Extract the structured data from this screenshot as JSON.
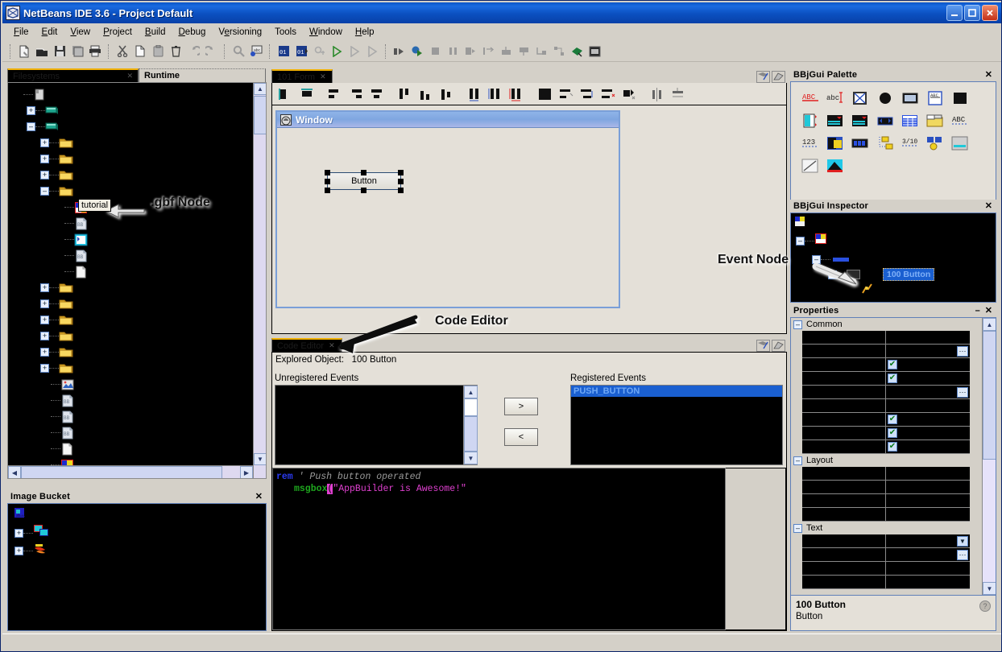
{
  "window": {
    "title": "NetBeans IDE 3.6 - Project Default",
    "icon": "netbeans-icon",
    "minimize": "0",
    "maximize": "1",
    "close": "X"
  },
  "menubar": {
    "items": [
      {
        "label": "File",
        "mnemonic": "F"
      },
      {
        "label": "Edit",
        "mnemonic": "E"
      },
      {
        "label": "View",
        "mnemonic": "V"
      },
      {
        "label": "Project",
        "mnemonic": "P"
      },
      {
        "label": "Build",
        "mnemonic": "B"
      },
      {
        "label": "Debug",
        "mnemonic": "D"
      },
      {
        "label": "Versioning",
        "mnemonic": "e"
      },
      {
        "label": "Tools",
        "mnemonic": "T"
      },
      {
        "label": "Window",
        "mnemonic": "W"
      },
      {
        "label": "Help",
        "mnemonic": "H"
      }
    ]
  },
  "toolbar": {
    "groups": [
      [
        "new-file-icon",
        "open-file-icon",
        "save-icon",
        "save-all-icon",
        "print-icon"
      ],
      [
        "cut-icon",
        "copy-icon",
        "paste-icon",
        "delete-icon",
        "undo-icon",
        "redo-icon"
      ],
      [
        "find-icon",
        "find-replace-icon"
      ],
      [
        "compile-icon",
        "compile-all-icon",
        "execute-stop-icon",
        "run-icon",
        "run-step-icon",
        "run-continue-icon"
      ],
      [
        "debug-step-icon",
        "debug-run-icon",
        "stop-icon",
        "pause-icon",
        "step-over-icon",
        "step-into-icon",
        "step-out-icon",
        "run-to-cursor-icon",
        "step-return-icon",
        "breakpoint-icon",
        "watch-icon",
        "debug-window-icon"
      ]
    ]
  },
  "explorer": {
    "tabs": [
      {
        "label": "Filesystems",
        "active": true,
        "closable": true
      },
      {
        "label": "Runtime",
        "active": false,
        "closable": false
      }
    ],
    "tree": {
      "nodes": [
        {
          "icon": "repository-icon",
          "depth": 0,
          "handle": ""
        },
        {
          "icon": "filesystem-icon",
          "depth": 1,
          "handle": "+"
        },
        {
          "icon": "filesystem-icon",
          "depth": 1,
          "handle": "-"
        },
        {
          "icon": "folder-icon",
          "depth": 2,
          "handle": "+"
        },
        {
          "icon": "folder-icon",
          "depth": 2,
          "handle": "+"
        },
        {
          "icon": "folder-icon",
          "depth": 2,
          "handle": "+"
        },
        {
          "icon": "folder-icon",
          "depth": 2,
          "handle": "-"
        },
        {
          "icon": "gbf-form-icon",
          "depth": 3,
          "handle": ""
        },
        {
          "icon": "bbj-program-icon",
          "depth": 3,
          "handle": ""
        },
        {
          "icon": "gbf-node-icon",
          "depth": 3,
          "handle": ""
        },
        {
          "icon": "bbj-program-icon",
          "depth": 3,
          "handle": ""
        },
        {
          "icon": "text-file-icon",
          "depth": 3,
          "handle": ""
        },
        {
          "icon": "folder-icon",
          "depth": 2,
          "handle": "+"
        },
        {
          "icon": "folder-icon",
          "depth": 2,
          "handle": "+"
        },
        {
          "icon": "folder-icon",
          "depth": 2,
          "handle": "+"
        },
        {
          "icon": "folder-icon",
          "depth": 2,
          "handle": "+"
        },
        {
          "icon": "folder-icon",
          "depth": 2,
          "handle": "+"
        },
        {
          "icon": "folder-icon",
          "depth": 2,
          "handle": "+"
        },
        {
          "icon": "image-file-icon",
          "depth": 2,
          "handle": ""
        },
        {
          "icon": "bbj-program-icon",
          "depth": 2,
          "handle": ""
        },
        {
          "icon": "bbj-program-icon",
          "depth": 2,
          "handle": ""
        },
        {
          "icon": "bbj-program-icon",
          "depth": 2,
          "handle": ""
        },
        {
          "icon": "text-file-icon",
          "depth": 2,
          "handle": ""
        },
        {
          "icon": "gbf-form-icon",
          "depth": 2,
          "handle": ""
        },
        {
          "icon": "bbj-program-icon",
          "depth": 2,
          "handle": ""
        },
        {
          "icon": "bbj-program-icon",
          "depth": 2,
          "handle": ""
        },
        {
          "icon": "bbj-program-icon",
          "depth": 2,
          "handle": ""
        },
        {
          "icon": "bbj-program-icon",
          "depth": 2,
          "handle": ""
        },
        {
          "icon": "bbj-program-icon",
          "depth": 2,
          "handle": ""
        }
      ]
    },
    "tooltip": "tutorial"
  },
  "image_bucket": {
    "title": "Image Bucket",
    "close": "✕",
    "nodes": [
      {
        "icon": "image-bucket-root-icon",
        "handle": ""
      },
      {
        "icon": "image-group-icon",
        "handle": "+"
      },
      {
        "icon": "image-group-icon",
        "handle": "+"
      }
    ]
  },
  "form_editor": {
    "tab": {
      "label": "101 Form",
      "close": "✕"
    },
    "window_buttons": [
      "float-icon",
      "maximize-icon"
    ],
    "designer_toolbar": [
      "align-left-edge-icon",
      "align-top-edge-icon",
      "align-left-icon",
      "align-right-icon",
      "align-center-icon",
      "align-top-icon",
      "align-bottom-icon",
      "align-middle-icon",
      "same-width-icon",
      "same-height-icon",
      "same-size-icon",
      "fill-icon",
      "space-horizontal-icon",
      "space-vertical-icon",
      "space-equal-icon",
      "group-icon",
      "center-horizontal-icon",
      "center-vertical-icon"
    ],
    "window": {
      "title": "Window",
      "icon": "window-icon",
      "button": {
        "label": "Button",
        "selected": true
      }
    }
  },
  "code_editor": {
    "tab": {
      "label": "Code Editor",
      "close": "✕"
    },
    "window_buttons": [
      "float-icon",
      "maximize-icon"
    ],
    "explored_object_label": "Explored Object:",
    "explored_object_value": "100 Button",
    "unregistered_label": "Unregistered Events",
    "registered_label": "Registered Events",
    "unregistered_events": [],
    "registered_events": [
      "PUSH_BUTTON"
    ],
    "add_button": ">",
    "remove_button": "<",
    "code": {
      "line1": {
        "keyword": "rem",
        "comment": "' Push button operated"
      },
      "line2": {
        "func": "msgbox",
        "caret": "(",
        "string": "\"AppBuilder is Awesome!\""
      }
    }
  },
  "palette": {
    "title": "BBjGui Palette",
    "close": "✕",
    "items": [
      "static-text-icon",
      "edit-field-icon",
      "checkbox-icon",
      "radio-button-icon",
      "button-icon",
      "child-window-icon",
      "list-button-icon",
      "list-edit-icon",
      "list-box-icon",
      "list-spinner-icon",
      "navigator-icon",
      "grid-icon",
      "tab-control-icon",
      "input-text-icon",
      "input-numeric-icon",
      "image-control-icon",
      "progress-bar-icon",
      "tree-icon",
      "status-bar-icon",
      "menu-icon",
      "scroll-bar-icon",
      "line-icon",
      "chart-icon"
    ]
  },
  "inspector": {
    "title": "BBjGui Inspector",
    "close": "✕",
    "nodes": [
      {
        "icon": "app-root-icon"
      },
      {
        "icon": "gbf-form-icon",
        "handle": "-"
      },
      {
        "icon": "window-node-icon",
        "handle": "-"
      },
      {
        "icon": "control-node-icon",
        "handle": "-"
      }
    ],
    "selected_node": "100 Button",
    "event_node_icon": "event-node-icon"
  },
  "properties": {
    "title": "Properties",
    "minimize": "–",
    "close": "✕",
    "sections": [
      {
        "name": "Common",
        "rows": [
          {
            "editor": "none"
          },
          {
            "editor": "ellipsis"
          },
          {
            "editor": "checkbox"
          },
          {
            "editor": "checkbox"
          },
          {
            "editor": "ellipsis"
          },
          {
            "editor": "none"
          },
          {
            "editor": "checkbox"
          },
          {
            "editor": "checkbox"
          },
          {
            "editor": "checkbox"
          }
        ]
      },
      {
        "name": "Layout",
        "rows": [
          {
            "editor": "none"
          },
          {
            "editor": "none"
          },
          {
            "editor": "none"
          },
          {
            "editor": "none"
          }
        ]
      },
      {
        "name": "Text",
        "rows": [
          {
            "editor": "dropdown"
          },
          {
            "editor": "ellipsis"
          },
          {
            "editor": "none"
          },
          {
            "editor": "none"
          }
        ]
      }
    ],
    "footer": {
      "title": "100 Button",
      "subtitle": "Button",
      "help": "?"
    }
  },
  "annotations": [
    {
      "id": "gbf-node",
      "text": ".gbf Node"
    },
    {
      "id": "code-editor",
      "text": "Code Editor"
    },
    {
      "id": "event-node",
      "text": "Event Node"
    }
  ],
  "colors": {
    "title_blue": "#0b50c0",
    "face": "#d4d0c8",
    "editor_face": "#e4e0d8",
    "selection_blue": "#1a5fd0",
    "tab_accent": "#f0b000",
    "panel_black": "#000000"
  }
}
